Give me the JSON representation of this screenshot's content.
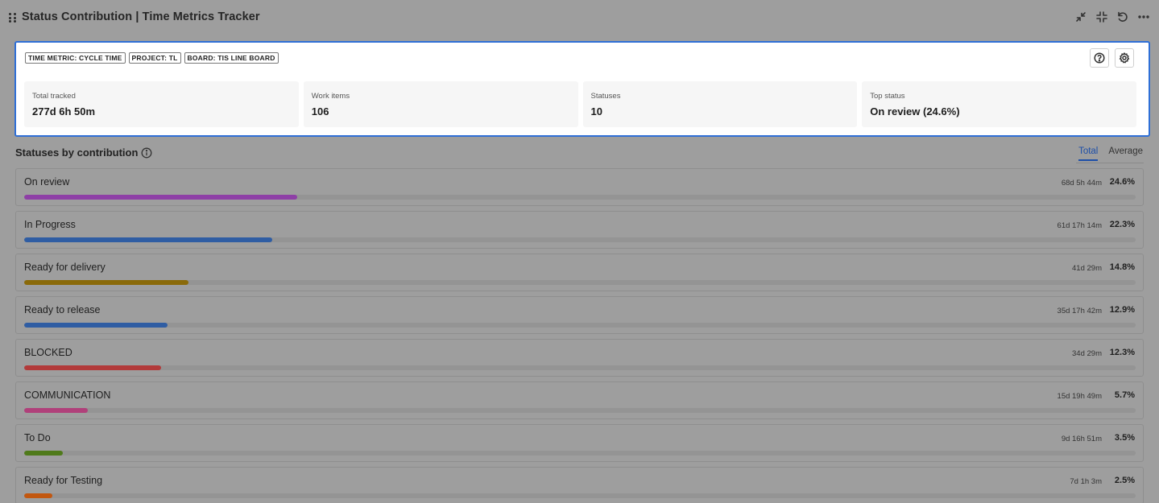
{
  "header": {
    "title": "Status Contribution | Time Metrics Tracker",
    "tools": [
      "collapse-icon",
      "minimize-icon",
      "refresh-icon",
      "more-icon"
    ]
  },
  "summary": {
    "chips": [
      "TIME METRIC: CYCLE TIME",
      "PROJECT: TL",
      "BOARD: TIS LINE BOARD"
    ],
    "stats": [
      {
        "label": "Total tracked",
        "value": "277d 6h 50m"
      },
      {
        "label": "Work items",
        "value": "106"
      },
      {
        "label": "Statuses",
        "value": "10"
      },
      {
        "label": "Top status",
        "value": "On review (24.6%)"
      }
    ]
  },
  "section": {
    "title": "Statuses by contribution",
    "tabs": [
      {
        "label": "Total",
        "active": true
      },
      {
        "label": "Average",
        "active": false
      }
    ]
  },
  "statuses": [
    {
      "name": "On review",
      "duration": "68d 5h 44m",
      "percent": "24.6%",
      "share": 0.246,
      "color": "#8e3fa6"
    },
    {
      "name": "In Progress",
      "duration": "61d 17h 14m",
      "percent": "22.3%",
      "share": 0.223,
      "color": "#2f5da3"
    },
    {
      "name": "Ready for delivery",
      "duration": "41d 29m",
      "percent": "14.8%",
      "share": 0.148,
      "color": "#8a6a0a"
    },
    {
      "name": "Ready to release",
      "duration": "35d 17h 42m",
      "percent": "12.9%",
      "share": 0.129,
      "color": "#2f5da3"
    },
    {
      "name": "BLOCKED",
      "duration": "34d 29m",
      "percent": "12.3%",
      "share": 0.123,
      "color": "#b23a3a"
    },
    {
      "name": "COMMUNICATION",
      "duration": "15d 19h 49m",
      "percent": "5.7%",
      "share": 0.057,
      "color": "#b0407a"
    },
    {
      "name": "To Do",
      "duration": "9d 16h 51m",
      "percent": "3.5%",
      "share": 0.035,
      "color": "#4f7a1a"
    },
    {
      "name": "Ready for Testing",
      "duration": "7d 1h 3m",
      "percent": "2.5%",
      "share": 0.025,
      "color": "#c2570f"
    }
  ]
}
